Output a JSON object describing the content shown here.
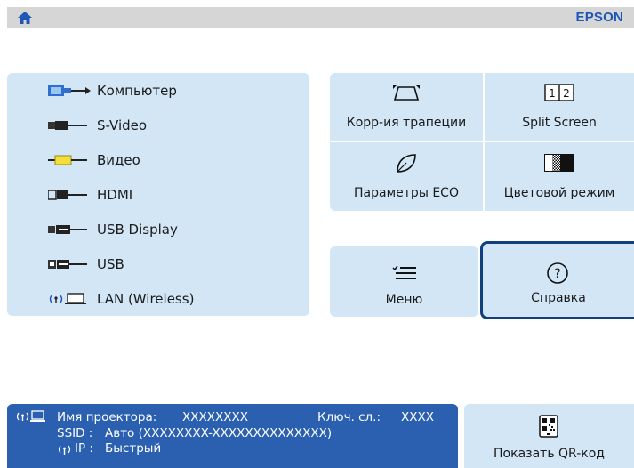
{
  "header": {
    "brand": "EPSON"
  },
  "sources": [
    {
      "label": "Компьютер",
      "icon": "computer-port-icon"
    },
    {
      "label": "S-Video",
      "icon": "svideo-port-icon"
    },
    {
      "label": "Видео",
      "icon": "video-port-icon"
    },
    {
      "label": "HDMI",
      "icon": "hdmi-port-icon"
    },
    {
      "label": "USB Display",
      "icon": "usb-display-port-icon"
    },
    {
      "label": "USB",
      "icon": "usb-port-icon"
    },
    {
      "label": "LAN (Wireless)",
      "icon": "lan-wireless-icon"
    }
  ],
  "tiles": {
    "keystone": "Корр-ия трапеции",
    "split_screen": "Split Screen",
    "split_screen_icon_text": [
      "1",
      "2"
    ],
    "eco": "Параметры ECO",
    "color_mode": "Цветовой режим",
    "menu": "Меню",
    "help": "Справка",
    "help_glyph": "?",
    "qr": "Показать QR-код"
  },
  "info": {
    "projector_name_label": "Имя проектора:",
    "projector_name_value": "XXXXXXXX",
    "key_label": "Ключ. сл.:",
    "key_value": "XXXX",
    "ssid_label": "SSID :",
    "ssid_value": "Авто (XXXXXXXX-XXXXXXXXXXXXXX)",
    "ip_label": "IP :",
    "ip_value": "Быстрый"
  },
  "colors": {
    "panel": "#d2e6f6",
    "accent": "#1f57b7",
    "info_bar": "#2b60b0",
    "focus_border": "#123f7e"
  }
}
